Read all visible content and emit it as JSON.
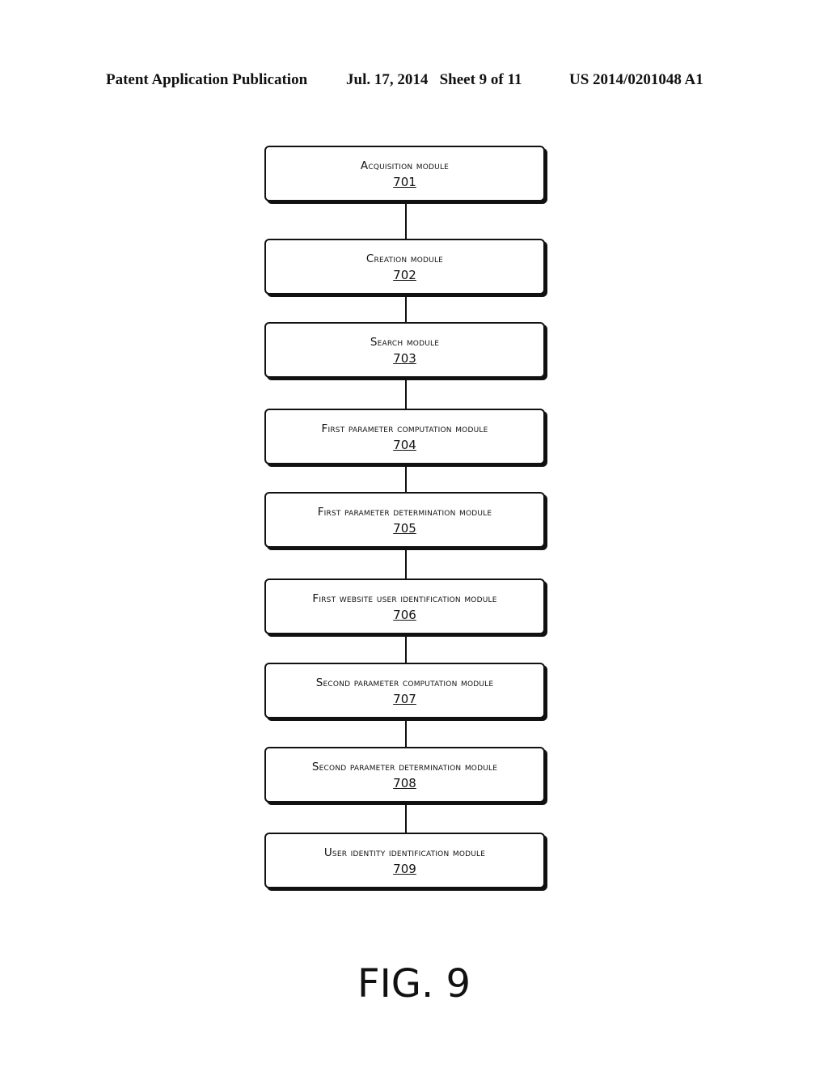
{
  "header": {
    "publication": "Patent Application Publication",
    "date_sheet": "Jul. 17, 2014   Sheet 9 of 11",
    "number": "US 2014/0201048 A1"
  },
  "modules": [
    {
      "label": "Acquisition module",
      "ref": "701"
    },
    {
      "label": "Creation module",
      "ref": "702"
    },
    {
      "label": "Search module",
      "ref": "703"
    },
    {
      "label": "First parameter computation module",
      "ref": "704"
    },
    {
      "label": "First parameter determination module",
      "ref": "705"
    },
    {
      "label": "First website user identification module",
      "ref": "706"
    },
    {
      "label": "Second parameter computation module",
      "ref": "707"
    },
    {
      "label": "Second parameter determination module",
      "ref": "708"
    },
    {
      "label": "User identity identification module",
      "ref": "709"
    }
  ],
  "figure_label": "FIG. 9"
}
